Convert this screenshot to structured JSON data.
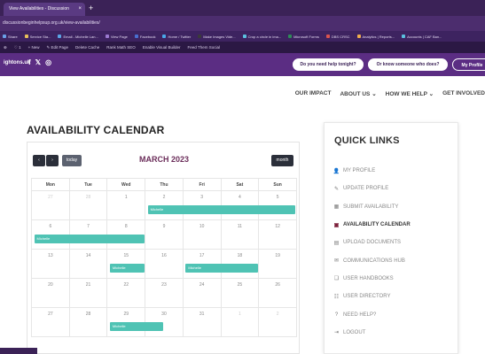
{
  "browser": {
    "tab_title": "View Availabilities - Discussion",
    "tab_close": "×",
    "new_tab": "+",
    "url": "discussionbeginhelpsup.org.uk/view-availabilities/",
    "bookmarks": [
      {
        "label": "Share",
        "color": "#6aa0e8"
      },
      {
        "label": "Service Sta...",
        "color": "#e8c05a"
      },
      {
        "label": "Email - Michelle Lan...",
        "color": "#5ba4e5"
      },
      {
        "label": "View Page",
        "color": "#9b7ad0"
      },
      {
        "label": "Facebook",
        "color": "#4a6fd0"
      },
      {
        "label": "Home / Twitter",
        "color": "#49a7e8"
      },
      {
        "label": "Make Images Vide...",
        "color": "#3a3a3a"
      },
      {
        "label": "Crop a circle in ima...",
        "color": "#5bc0de"
      },
      {
        "label": "Microsoft Forms",
        "color": "#2e8b57"
      },
      {
        "label": "DBS CRSC",
        "color": "#d9534f"
      },
      {
        "label": "Analytics | Reports...",
        "color": "#f0ad4e"
      },
      {
        "label": "Accounts | CAF Ban...",
        "color": "#5bc0de"
      }
    ],
    "wp_items": [
      "⊕",
      "♡ 1",
      "+ New",
      "✎ Edit Page",
      "Delete Cache",
      "Rank Math SEO",
      "Enable Visual Builder",
      "Feed Them Social"
    ]
  },
  "header": {
    "domain": "ightons.uk",
    "social": [
      "f",
      "𝕏",
      "◎"
    ],
    "buttons": [
      "Do you need help tonight?",
      "Or know someone who does?",
      "My Profile"
    ]
  },
  "nav": [
    "OUR IMPACT",
    "ABOUT US ⌄",
    "HOW WE HELP ⌄",
    "GET INVOLVED"
  ],
  "calendar": {
    "title": "AVAILABILITY CALENDAR",
    "prev": "‹",
    "next": "›",
    "today": "today",
    "month_view": "month",
    "month_label": "MARCH 2023",
    "weekdays": [
      "Mon",
      "Tue",
      "Wed",
      "Thu",
      "Fri",
      "Sat",
      "Sun"
    ],
    "weeks": [
      [
        "27",
        "28",
        "1",
        "2",
        "3",
        "4",
        "5"
      ],
      [
        "6",
        "7",
        "8",
        "9",
        "10",
        "11",
        "12"
      ],
      [
        "13",
        "14",
        "15",
        "16",
        "17",
        "18",
        "19"
      ],
      [
        "20",
        "21",
        "22",
        "23",
        "24",
        "25",
        "26"
      ],
      [
        "27",
        "28",
        "29",
        "30",
        "31",
        "1",
        "2"
      ]
    ],
    "events": [
      {
        "label": "Michelle",
        "week": 0,
        "start": 3,
        "span": 4
      },
      {
        "label": "Michelle",
        "week": 1,
        "start": 0,
        "span": 3
      },
      {
        "label": "Michelle",
        "week": 2,
        "start": 2,
        "span": 1
      },
      {
        "label": "Michelle",
        "week": 2,
        "start": 4,
        "span": 2
      },
      {
        "label": "Michelle",
        "week": 4,
        "start": 2,
        "span": 1.5
      }
    ]
  },
  "quick_links": {
    "title": "QUICK LINKS",
    "items": [
      {
        "label": "MY PROFILE",
        "icon": "user-icon",
        "glyph": "👤"
      },
      {
        "label": "UPDATE PROFILE",
        "icon": "user-edit-icon",
        "glyph": "✎"
      },
      {
        "label": "SUBMIT AVAILABILITY",
        "icon": "calendar-icon",
        "glyph": "▦"
      },
      {
        "label": "AVAILABILITY CALENDAR",
        "icon": "calendar-active-icon",
        "glyph": "▣"
      },
      {
        "label": "UPLOAD DOCUMENTS",
        "icon": "document-icon",
        "glyph": "▤"
      },
      {
        "label": "COMMUNICATIONS HUB",
        "icon": "chat-icon",
        "glyph": "✉"
      },
      {
        "label": "USER HANDBOOKS",
        "icon": "book-icon",
        "glyph": "❏"
      },
      {
        "label": "USER DIRECTORY",
        "icon": "directory-icon",
        "glyph": "☷"
      },
      {
        "label": "NEED HELP?",
        "icon": "help-icon",
        "glyph": "?"
      },
      {
        "label": "LOGOUT",
        "icon": "logout-icon",
        "glyph": "⇥"
      }
    ]
  }
}
